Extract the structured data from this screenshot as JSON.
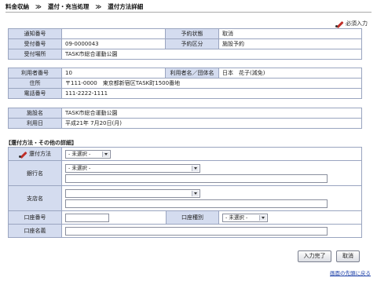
{
  "breadcrumb": {
    "step1": "料金収納",
    "sep": "≫",
    "step2": "還付・充当処理",
    "step3": "還付方法詳細"
  },
  "required_note": "必須入力",
  "table1": {
    "rows": [
      {
        "l1": "通知番号",
        "v1": "",
        "l2": "予約状態",
        "v2": "取消"
      },
      {
        "l1": "受付番号",
        "v1": "09-0000043",
        "l2": "予約区分",
        "v2": "施設予約"
      },
      {
        "l1": "受付場所",
        "v1": "TASK市総合運動公園"
      }
    ]
  },
  "table2": {
    "user_no_label": "利用者番号",
    "user_no": "10",
    "name_label": "利用者名／団体名",
    "name": "日本　花子(減免)",
    "address_label": "住所",
    "address": "〒111-0000　東京都新宿区TASK町1500番地",
    "phone_label": "電話番号",
    "phone": "111-2222-1111"
  },
  "table3": {
    "facility_label": "施設名",
    "facility": "TASK市総合運動公園",
    "date_label": "利用日",
    "date": "平成21年 7月20日(月)"
  },
  "section_title": "【還付方法・その他の詳細】",
  "form": {
    "method_label": "還付方法",
    "method_value": "- 未選択 -",
    "bank_label": "銀行名",
    "bank_value": "- 未選択 -",
    "branch_label": "支店名",
    "branch_value": "",
    "account_no_label": "口座番号",
    "account_type_label": "口座種別",
    "account_type_value": "- 未選択 -",
    "account_name_label": "口座名義"
  },
  "buttons": {
    "complete": "入力完了",
    "cancel": "取消"
  },
  "back_to_top": "画面の先頭に戻る"
}
